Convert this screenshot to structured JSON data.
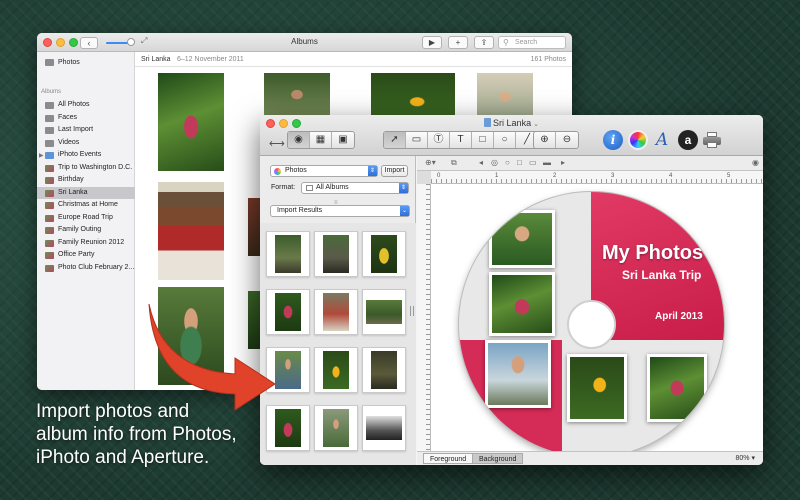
{
  "photos_window": {
    "title": "Albums",
    "search_placeholder": "Search",
    "top_item": "Photos",
    "section": "Albums",
    "sidebar": [
      {
        "label": "All Photos",
        "icon": "photos-icon"
      },
      {
        "label": "Faces",
        "icon": "faces-icon"
      },
      {
        "label": "Last Import",
        "icon": "clock-icon"
      },
      {
        "label": "Videos",
        "icon": "video-icon"
      },
      {
        "label": "iPhoto Events",
        "icon": "folder-icon"
      },
      {
        "label": "Trip to Washington D.C.",
        "icon": "album-icon"
      },
      {
        "label": "Birthday",
        "icon": "album-icon"
      },
      {
        "label": "Sri Lanka",
        "icon": "album-icon"
      },
      {
        "label": "Christmas at Home",
        "icon": "album-icon"
      },
      {
        "label": "Europe Road Trip",
        "icon": "album-icon"
      },
      {
        "label": "Family Outing",
        "icon": "album-icon"
      },
      {
        "label": "Family Reunion 2012",
        "icon": "album-icon"
      },
      {
        "label": "Office Party",
        "icon": "album-icon"
      },
      {
        "label": "Photo Club February 2...",
        "icon": "album-icon"
      }
    ],
    "selected_index": 7,
    "header_place": "Sri Lanka",
    "header_dates": "6–12 November 2011",
    "header_count": "161 Photos"
  },
  "app_window": {
    "title": "Sri Lanka",
    "source": "Photos",
    "import_label": "Import",
    "format_label": "Format:",
    "format_value": "All Albums",
    "results_label": "Import Results",
    "tabs": [
      "Foreground",
      "Background"
    ],
    "zoom": "80%",
    "ruler_ticks": [
      "0",
      "1",
      "2",
      "3",
      "4",
      "5"
    ]
  },
  "disc": {
    "title": "My Photos",
    "subtitle": "Sri Lanka Trip",
    "date": "April 2013"
  },
  "caption": [
    "Import  photos and",
    "album info from Photos,",
    "iPhoto and Aperture."
  ],
  "colors": {
    "accent_red": "#d52b57",
    "select_blue": "#3b7de0",
    "arrow": "#e0432a"
  }
}
